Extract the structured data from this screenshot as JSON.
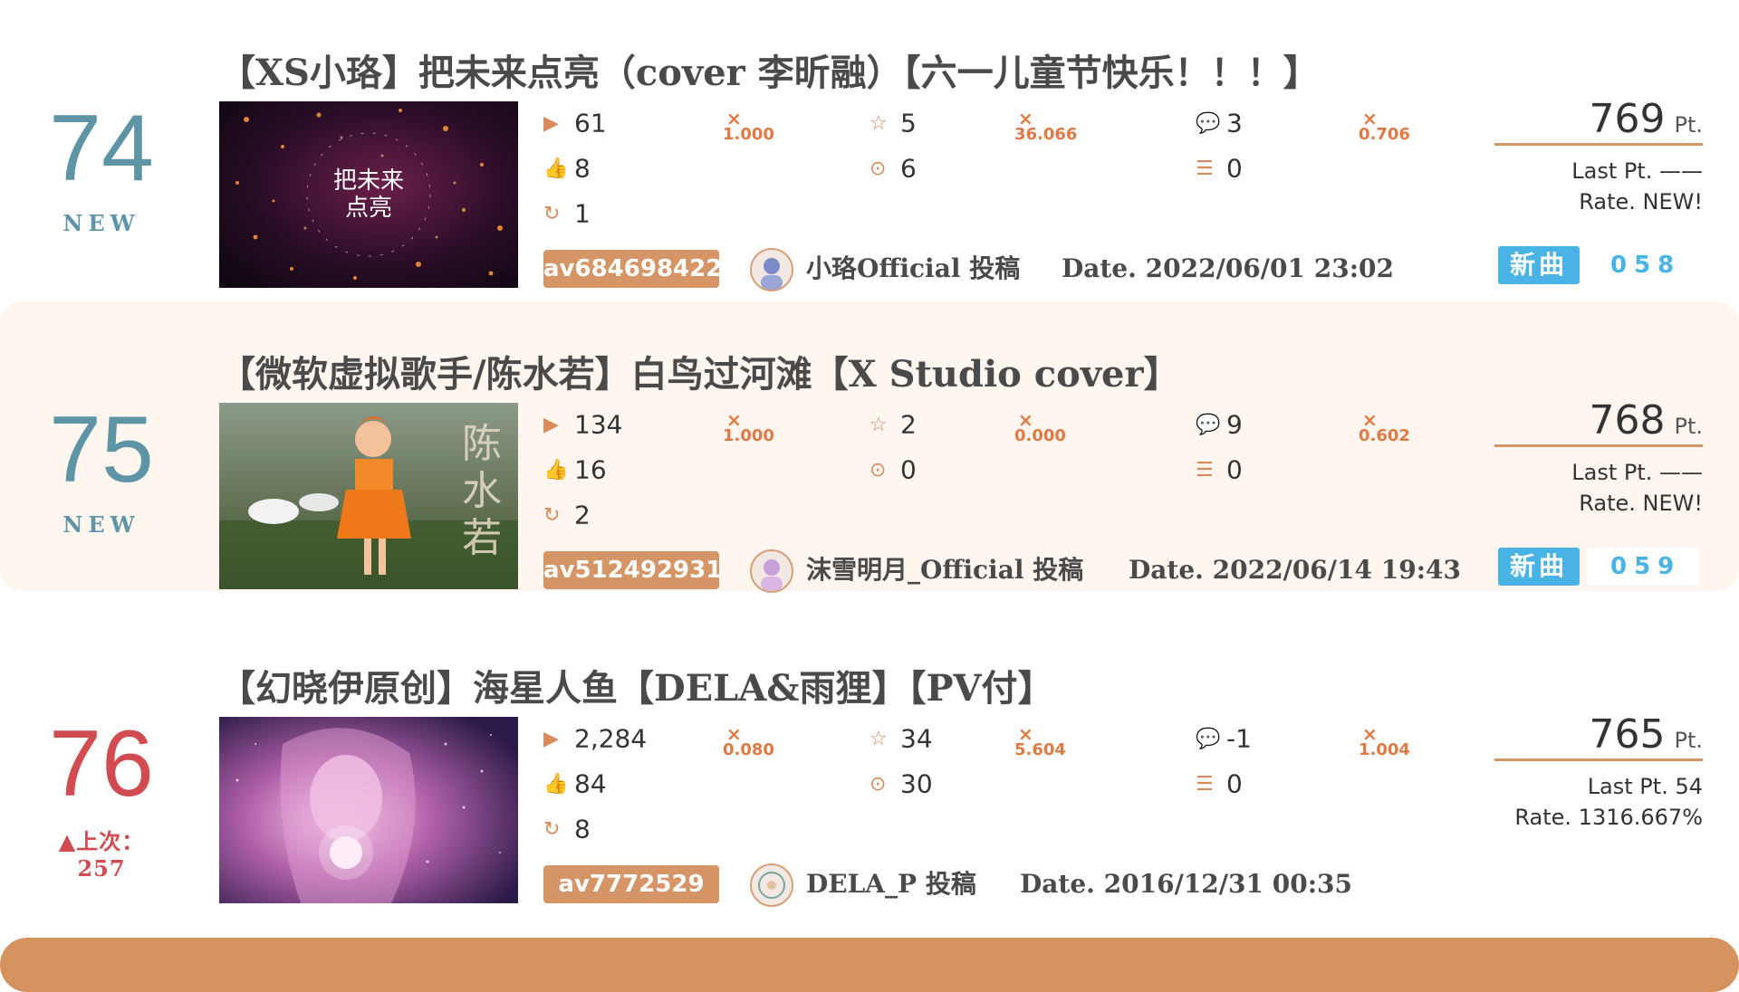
{
  "entries": [
    {
      "rank": "74",
      "sub": "NEW",
      "title": "【XS小珞】把未来点亮（cover 李昕融）【六一儿童节快乐！！！】",
      "thumb_text": "把未来\n点亮",
      "views": "61",
      "likes": "8",
      "shares": "1",
      "favorites": "5",
      "coins": "6",
      "comments": "3",
      "danmaku": "0",
      "mult_views": "1.000",
      "mult_fav": "36.066",
      "mult_comments": "0.706",
      "av": "av684698422",
      "uploader": "小珞Official 投稿",
      "date": "Date. 2022/06/01 23:02",
      "points": "769",
      "unit": "Pt.",
      "last_pt": "Last Pt. ——",
      "rate": "Rate. NEW!",
      "new_tag": "新曲",
      "index": "058"
    },
    {
      "rank": "75",
      "sub": "NEW",
      "title": "【微软虚拟歌手/陈水若】白鸟过河滩【X Studio cover】",
      "thumb_text": "陈\n水\n若",
      "views": "134",
      "likes": "16",
      "shares": "2",
      "favorites": "2",
      "coins": "0",
      "comments": "9",
      "danmaku": "0",
      "mult_views": "1.000",
      "mult_fav": "0.000",
      "mult_comments": "0.602",
      "av": "av512492931",
      "uploader": "沫雪明月_Official 投稿",
      "date": "Date. 2022/06/14 19:43",
      "points": "768",
      "unit": "Pt.",
      "last_pt": "Last Pt. ——",
      "rate": "Rate. NEW!",
      "new_tag": "新曲",
      "index": "059"
    },
    {
      "rank": "76",
      "sub": "▲上次：257",
      "title": "【幻晓伊原创】海星人鱼【DELA&雨狸】【PV付】",
      "thumb_text": "",
      "views": "2,284",
      "likes": "84",
      "shares": "8",
      "favorites": "34",
      "coins": "30",
      "comments": "-1",
      "danmaku": "0",
      "mult_views": "0.080",
      "mult_fav": "5.604",
      "mult_comments": "1.004",
      "av": "av7772529",
      "uploader": "DELA_P 投稿",
      "date": "Date. 2016/12/31 00:35",
      "points": "765",
      "unit": "Pt.",
      "last_pt": "Last Pt. 54",
      "rate": "Rate. 1316.667%"
    }
  ],
  "mult_symbol": "×",
  "colors": {
    "accent": "#d69566",
    "rank_new": "#5d94a6",
    "rank_up": "#d24b50",
    "new_tag": "#4ab3e6",
    "mult": "#e07a45"
  },
  "icons": [
    "play-icon",
    "like-icon",
    "share-icon",
    "star-icon",
    "coin-icon",
    "comment-icon",
    "danmaku-icon"
  ]
}
